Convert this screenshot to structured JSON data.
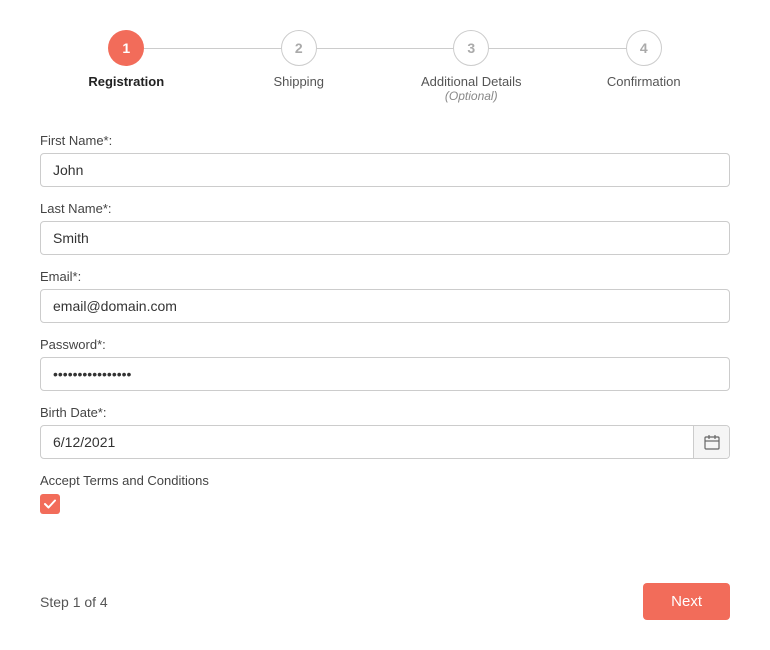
{
  "stepper": {
    "steps": [
      {
        "number": "1",
        "label": "Registration",
        "sublabel": "",
        "active": true
      },
      {
        "number": "2",
        "label": "Shipping",
        "sublabel": "",
        "active": false
      },
      {
        "number": "3",
        "label": "Additional Details",
        "sublabel": "(Optional)",
        "active": false
      },
      {
        "number": "4",
        "label": "Confirmation",
        "sublabel": "",
        "active": false
      }
    ]
  },
  "form": {
    "fields": [
      {
        "id": "first-name",
        "label": "First Name*:",
        "type": "text",
        "value": "John",
        "placeholder": ""
      },
      {
        "id": "last-name",
        "label": "Last Name*:",
        "type": "text",
        "value": "Smith",
        "placeholder": ""
      },
      {
        "id": "email",
        "label": "Email*:",
        "type": "email",
        "value": "email@domain.com",
        "placeholder": ""
      },
      {
        "id": "password",
        "label": "Password*:",
        "type": "password",
        "value": "•••••••••••••••••",
        "placeholder": ""
      },
      {
        "id": "birthdate",
        "label": "Birth Date*:",
        "type": "text",
        "value": "6/12/2021",
        "placeholder": ""
      }
    ],
    "checkbox": {
      "label": "Accept Terms and Conditions",
      "checked": true
    }
  },
  "footer": {
    "step_indicator": "Step 1 of 4",
    "next_button": "Next"
  },
  "colors": {
    "accent": "#f26c5a"
  }
}
